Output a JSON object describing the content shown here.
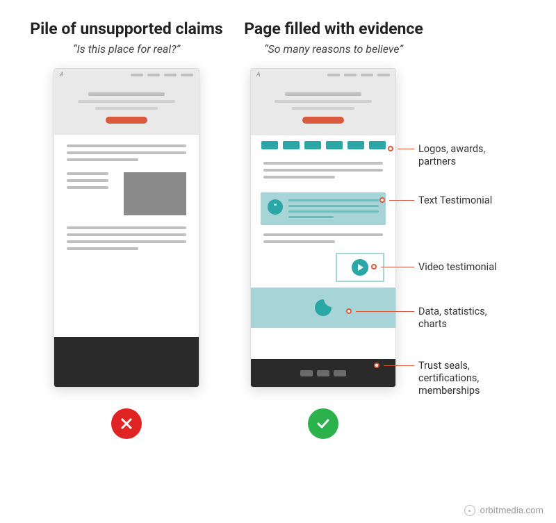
{
  "left": {
    "heading": "Pile of unsupported claims",
    "quote": "“Is this place for real?”"
  },
  "right": {
    "heading": "Page filled with evidence",
    "quote": "“So many reasons to believe”"
  },
  "callouts": {
    "logos": "Logos, awards, partners",
    "testimonial": "Text Testimonial",
    "video": "Video testimonial",
    "data": "Data, statistics, charts",
    "trust": "Trust seals, certifications, memberships"
  },
  "credit": "orbitmedia.com",
  "phone_logo": "A"
}
